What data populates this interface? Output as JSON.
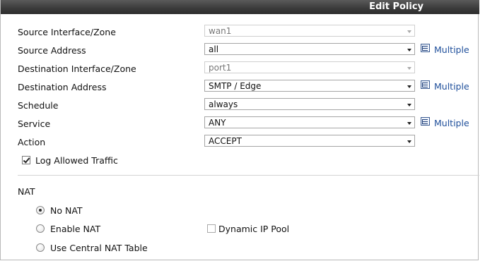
{
  "header": {
    "title": "Edit Policy"
  },
  "fields": [
    {
      "label": "Source Interface/Zone",
      "value": "wan1",
      "disabled": true,
      "multiple": ""
    },
    {
      "label": "Source Address",
      "value": "all",
      "disabled": false,
      "multiple": "Multiple"
    },
    {
      "label": "Destination Interface/Zone",
      "value": "port1",
      "disabled": true,
      "multiple": ""
    },
    {
      "label": "Destination Address",
      "value": "SMTP / Edge",
      "disabled": false,
      "multiple": "Multiple"
    },
    {
      "label": "Schedule",
      "value": "always",
      "disabled": false,
      "multiple": ""
    },
    {
      "label": "Service",
      "value": "ANY",
      "disabled": false,
      "multiple": "Multiple"
    },
    {
      "label": "Action",
      "value": "ACCEPT",
      "disabled": false,
      "multiple": ""
    }
  ],
  "log_allowed": {
    "label": "Log Allowed Traffic",
    "checked": true
  },
  "nat": {
    "section_label": "NAT",
    "options": [
      {
        "label": "No NAT",
        "selected": true
      },
      {
        "label": "Enable NAT",
        "selected": false
      },
      {
        "label": "Use Central NAT Table",
        "selected": false
      }
    ],
    "dynamic_ip_pool": {
      "label": "Dynamic IP Pool",
      "checked": false
    }
  },
  "colors": {
    "link": "#1f4f9b",
    "titlebar": "#3a3a3a"
  }
}
